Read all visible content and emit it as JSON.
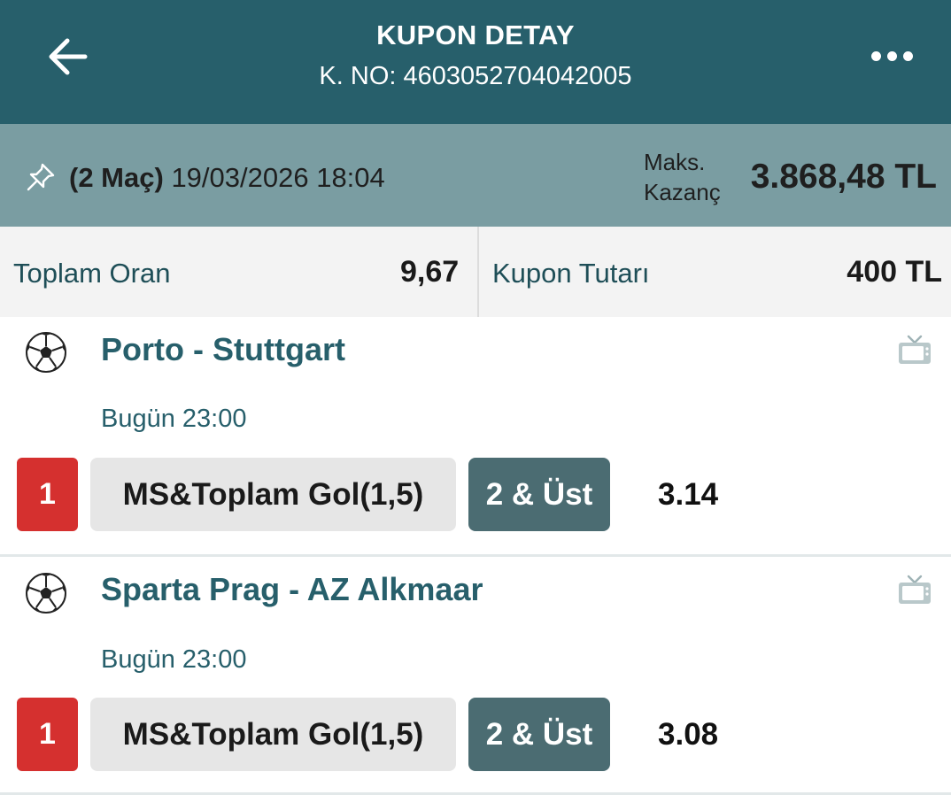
{
  "header": {
    "title": "KUPON DETAY",
    "coupon_no": "K. NO: 4603052704042005"
  },
  "info": {
    "match_count": "(2 Maç)",
    "datetime": "19/03/2026 18:04",
    "max_win_label_line1": "Maks.",
    "max_win_label_line2": "Kazanç",
    "max_win_value": "3.868,48 TL"
  },
  "totals": {
    "total_odds_label": "Toplam Oran",
    "total_odds_value": "9,67",
    "stake_label": "Kupon Tutarı",
    "stake_value": "400 TL"
  },
  "matches": [
    {
      "teams": "Porto - Stuttgart",
      "time": "Bugün 23:00",
      "selection_code": "1",
      "market": "MS&Toplam Gol(1,5)",
      "pick": "2 & Üst",
      "odds": "3.14"
    },
    {
      "teams": "Sparta Prag - AZ Alkmaar",
      "time": "Bugün 23:00",
      "selection_code": "1",
      "market": "MS&Toplam Gol(1,5)",
      "pick": "2 & Üst",
      "odds": "3.08"
    }
  ],
  "icons": {
    "back": "arrow-left-icon",
    "more": "more-dots-icon",
    "pin": "pin-icon",
    "sport": "soccer-ball-icon",
    "tv": "tv-icon"
  },
  "colors": {
    "header_bg": "#275f6b",
    "info_bg": "#7a9da2",
    "selection_red": "#d5302f",
    "pick_bg": "#4b6c72",
    "match_title": "#275f6b"
  }
}
